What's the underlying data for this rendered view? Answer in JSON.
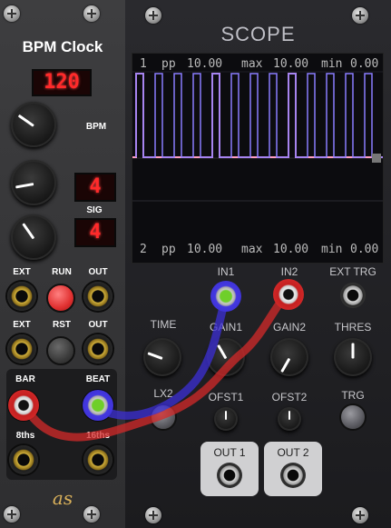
{
  "bpm_clock": {
    "title": "BPM Clock",
    "bpm_display": "120",
    "bpm_label": "BPM",
    "sig_top_display": "4",
    "sig_label": "SIG",
    "sig_bottom_display": "4",
    "row1": {
      "ext": "EXT",
      "run": "RUN",
      "out": "OUT"
    },
    "row2": {
      "ext": "EXT",
      "rst": "RST",
      "out": "OUT"
    },
    "bar_label": "BAR",
    "beat_label": "BEAT",
    "eighths_label": "8ths",
    "sixteenths_label": "16ths",
    "logo_text": "as"
  },
  "scope": {
    "title": "SCOPE",
    "ch1": {
      "index": "1",
      "pp_label": "pp",
      "pp": "10.00",
      "max_label": "max",
      "max": "10.00",
      "min_label": "min",
      "min": "0.00"
    },
    "ch2": {
      "index": "2",
      "pp_label": "pp",
      "pp": "10.00",
      "max_label": "max",
      "max": "10.00",
      "min_label": "min",
      "min": "0.00"
    },
    "in1_label": "IN1",
    "in2_label": "IN2",
    "ext_trg_label": "EXT TRG",
    "time_label": "TIME",
    "gain1_label": "GAIN1",
    "gain2_label": "GAIN2",
    "thres_label": "THRES",
    "lx2_label": "LX2",
    "ofst1_label": "OFST1",
    "ofst2_label": "OFST2",
    "trg_label": "TRG",
    "out1_label": "OUT 1",
    "out2_label": "OUT 2"
  },
  "colors": {
    "cable_red": "#d42a2a",
    "cable_blue": "#3c2fd6",
    "trace_in1": "#8a7cff",
    "trace_in2": "#ff9ec0",
    "led_red": "#ff2a2a"
  }
}
